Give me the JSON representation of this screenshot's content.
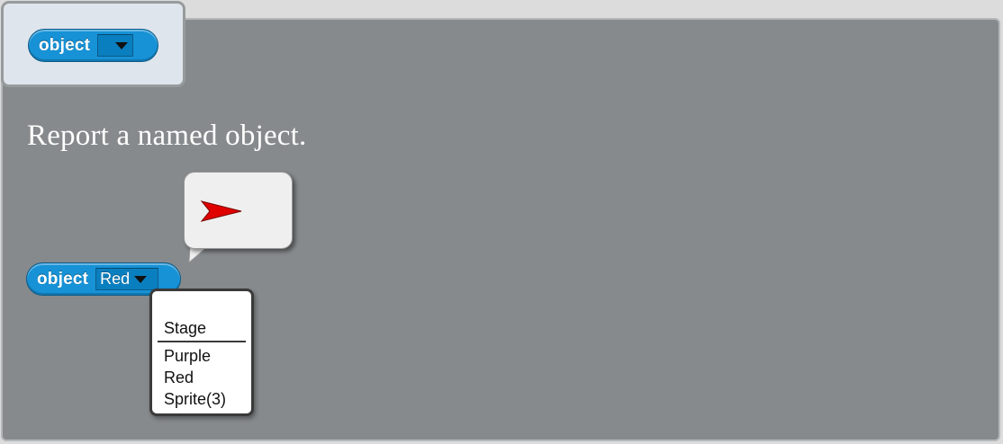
{
  "palette_block": {
    "label": "object",
    "slot_value": ""
  },
  "description": "Report a named object.",
  "example_block": {
    "label": "object",
    "slot_value": "Red"
  },
  "speech_bubble": {
    "content_icon": "red-arrow-sprite-icon"
  },
  "dropdown_menu": {
    "items": [
      {
        "label": "Stage"
      },
      {
        "label": "Purple"
      },
      {
        "label": "Red"
      },
      {
        "label": "Sprite(3)"
      }
    ]
  },
  "colors": {
    "block": "#1792d6",
    "panel": "#868a8c",
    "tab": "#dfe5ec",
    "sprite_arrow": "#e00000"
  }
}
